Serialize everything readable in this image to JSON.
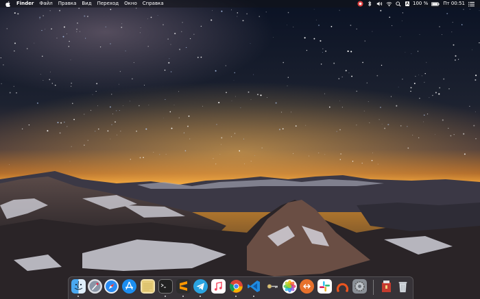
{
  "menubar": {
    "app_name": "Finder",
    "menus": [
      "Файл",
      "Правка",
      "Вид",
      "Переход",
      "Окно",
      "Справка"
    ],
    "battery": "100 %",
    "clock": "Пт 00:51",
    "input_source": "A",
    "status_icons": [
      "notification-app-icon",
      "bluetooth-icon",
      "volume-icon",
      "wifi-icon",
      "spotlight-search-icon",
      "keyboard-layout-icon",
      "battery-icon",
      "notification-center-icon"
    ]
  },
  "dock": {
    "apps": [
      {
        "name": "Finder",
        "icon": "finder-icon",
        "running": true
      },
      {
        "name": "Launchpad",
        "icon": "launchpad-icon",
        "running": false
      },
      {
        "name": "Safari",
        "icon": "safari-icon",
        "running": false
      },
      {
        "name": "App Store",
        "icon": "app-store-icon",
        "running": false
      },
      {
        "name": "Notes",
        "icon": "notes-icon",
        "running": false
      },
      {
        "name": "Terminal",
        "icon": "terminal-icon",
        "running": true
      },
      {
        "name": "Sublime Text",
        "icon": "sublime-text-icon",
        "running": true
      },
      {
        "name": "Telegram",
        "icon": "telegram-icon",
        "running": true
      },
      {
        "name": "Music",
        "icon": "music-icon",
        "running": false
      },
      {
        "name": "Chrome",
        "icon": "chrome-icon",
        "running": true
      },
      {
        "name": "VS Code",
        "icon": "vscode-icon",
        "running": true
      },
      {
        "name": "Keychain",
        "icon": "keychain-icon",
        "running": false
      },
      {
        "name": "Photos",
        "icon": "photos-icon",
        "running": false
      },
      {
        "name": "Remote Desktop",
        "icon": "remote-desktop-icon",
        "running": false
      },
      {
        "name": "Slack",
        "icon": "slack-icon",
        "running": false
      },
      {
        "name": "Ubuntu One",
        "icon": "ubuntu-icon",
        "running": false
      },
      {
        "name": "System Preferences",
        "icon": "system-preferences-icon",
        "running": false
      },
      {
        "name": "Archive",
        "icon": "archive-icon",
        "running": false
      },
      {
        "name": "Trash",
        "icon": "trash-icon",
        "running": false
      }
    ]
  },
  "colors": {
    "sky_top": "#0b1426",
    "horizon_glow": "#f0a030",
    "snow": "#e8e8ee"
  }
}
